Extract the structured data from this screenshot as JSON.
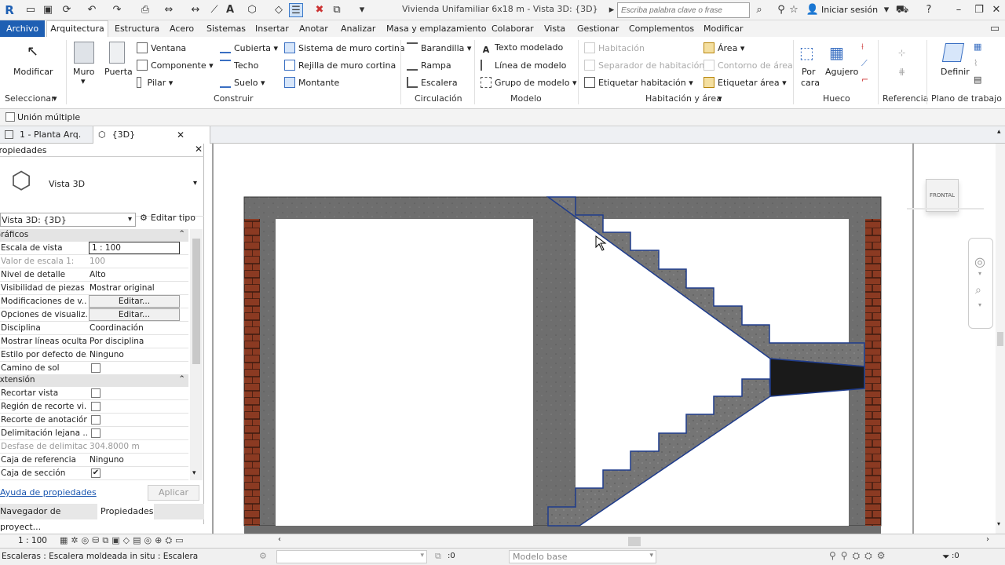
{
  "app": {
    "title": "Vivienda Unifamiliar 6x18 m - Vista 3D: {3D}",
    "logo": "R"
  },
  "search": {
    "placeholder": "Escriba palabra clave o frase"
  },
  "account": {
    "signin_label": "Iniciar sesión"
  },
  "tabs": [
    "Archivo",
    "Arquitectura",
    "Estructura",
    "Acero",
    "Sistemas",
    "Insertar",
    "Anotar",
    "Analizar",
    "Masa y emplazamiento",
    "Colaborar",
    "Vista",
    "Gestionar",
    "Complementos",
    "Modificar"
  ],
  "ribbon": {
    "seleccionar": {
      "modificar": "Modificar",
      "group": "Seleccionar"
    },
    "construir": {
      "muro": "Muro",
      "puerta": "Puerta",
      "ventana": "Ventana",
      "componente": "Componente",
      "pilar": "Pilar",
      "cubierta": "Cubierta",
      "techo": "Techo",
      "suelo": "Suelo",
      "muro_cortina": "Sistema de muro cortina",
      "rejilla": "Rejilla de muro cortina",
      "montante": "Montante",
      "group": "Construir"
    },
    "circulacion": {
      "barandilla": "Barandilla",
      "rampa": "Rampa",
      "escalera": "Escalera",
      "group": "Circulación"
    },
    "modelo": {
      "texto": "Texto modelado",
      "linea": "Línea de modelo",
      "grupo": "Grupo de modelo",
      "group": "Modelo"
    },
    "habitacion": {
      "habitacion": "Habitación",
      "separador": "Separador de habitación",
      "etiquetar_hab": "Etiquetar habitación",
      "area": "Área",
      "contorno": "Contorno de área",
      "etiquetar_area": "Etiquetar área",
      "group": "Habitación y área"
    },
    "hueco": {
      "por_cara_1": "Por",
      "por_cara_2": "cara",
      "agujero": "Agujero",
      "group": "Hueco"
    },
    "referencia": {
      "group": "Referencia"
    },
    "plano": {
      "definir": "Definir",
      "group": "Plano de trabajo"
    }
  },
  "options": {
    "union_multiple": "Unión múltiple"
  },
  "view_tabs": {
    "planta": "1 - Planta Arq.",
    "vista3d": "{3D}"
  },
  "properties": {
    "title": "Propiedades",
    "type_name": "Vista 3D",
    "selector": "Vista 3D: {3D}",
    "edit_type": "Editar tipo",
    "sections": {
      "graficos": "Gráficos",
      "extension": "Extensión"
    },
    "graficos": [
      {
        "k": "Escala de vista",
        "v": "1 : 100",
        "kind": "input"
      },
      {
        "k": "Valor de escala    1:",
        "v": "100",
        "kind": "disabled"
      },
      {
        "k": "Nivel de detalle",
        "v": "Alto"
      },
      {
        "k": "Visibilidad de piezas",
        "v": "Mostrar original"
      },
      {
        "k": "Modificaciones de v...",
        "v": "Editar...",
        "kind": "button"
      },
      {
        "k": "Opciones de visualiz...",
        "v": "Editar...",
        "kind": "button"
      },
      {
        "k": "Disciplina",
        "v": "Coordinación"
      },
      {
        "k": "Mostrar líneas ocultas",
        "v": "Por disciplina"
      },
      {
        "k": "Estilo por defecto de...",
        "v": "Ninguno"
      },
      {
        "k": "Camino de sol",
        "v": "",
        "kind": "check",
        "checked": false
      }
    ],
    "extension": [
      {
        "k": "Recortar vista",
        "v": "",
        "kind": "check",
        "checked": false
      },
      {
        "k": "Región de recorte vi...",
        "v": "",
        "kind": "check",
        "checked": false
      },
      {
        "k": "Recorte de anotación",
        "v": "",
        "kind": "check",
        "checked": false
      },
      {
        "k": "Delimitación lejana ...",
        "v": "",
        "kind": "check",
        "checked": false
      },
      {
        "k": "Desfase de delimitac...",
        "v": "304.8000 m",
        "kind": "disabled"
      },
      {
        "k": "Caja de referencia",
        "v": "Ninguno"
      },
      {
        "k": "Caja de sección",
        "v": "",
        "kind": "check",
        "checked": true
      }
    ],
    "help": "Ayuda de propiedades",
    "apply": "Aplicar",
    "bottom_tabs": [
      "Navegador de proyect...",
      "Propiedades"
    ]
  },
  "viewcube": {
    "face": "FRONTAL"
  },
  "statusbar": {
    "scale": "1 : 100"
  },
  "bottom": {
    "status": "Escaleras : Escalera moldeada in situ : Escalera",
    "model": "Modelo base",
    "count": ":0",
    "filter": ":0"
  },
  "colors": {
    "accent": "#1e5fb3",
    "concrete": "#6e6e6e",
    "brick": "#8b3a22",
    "selection": "#1f3c8c"
  }
}
